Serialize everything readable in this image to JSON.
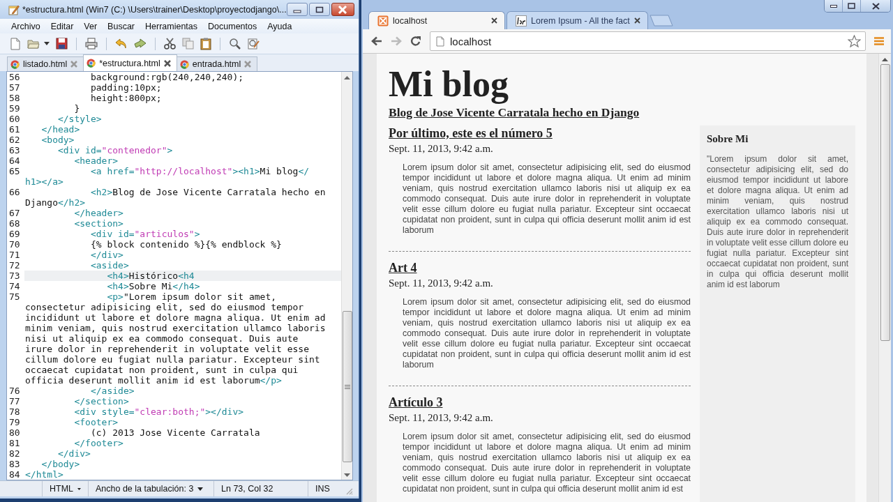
{
  "editor": {
    "title": "*estructura.html (Win7 (C:) \\Users\\trainer\\Desktop\\proyectodjango\\...",
    "menu": [
      "Archivo",
      "Editar",
      "Ver",
      "Buscar",
      "Herramientas",
      "Documentos",
      "Ayuda"
    ],
    "tabs": [
      {
        "label": "listado.html",
        "selected": false
      },
      {
        "label": "*estructura.html",
        "selected": true
      },
      {
        "label": "entrada.html",
        "selected": false
      }
    ],
    "lines": [
      {
        "number": "56",
        "current": false,
        "rows": [
          [
            {
              "kind": "text",
              "text": "            background:rgb(240,240,240);"
            }
          ]
        ]
      },
      {
        "number": "57",
        "current": false,
        "rows": [
          [
            {
              "kind": "text",
              "text": "            padding:10px;"
            }
          ]
        ]
      },
      {
        "number": "58",
        "current": false,
        "rows": [
          [
            {
              "kind": "text",
              "text": "            height:800px;"
            }
          ]
        ]
      },
      {
        "number": "59",
        "current": false,
        "rows": [
          [
            {
              "kind": "text",
              "text": "         }"
            }
          ]
        ]
      },
      {
        "number": "60",
        "current": false,
        "rows": [
          [
            {
              "kind": "markup",
              "text": "      </style>"
            }
          ]
        ]
      },
      {
        "number": "61",
        "current": false,
        "rows": [
          [
            {
              "kind": "markup",
              "text": "   </head>"
            }
          ]
        ]
      },
      {
        "number": "62",
        "current": false,
        "rows": [
          [
            {
              "kind": "markup",
              "text": "   <body>"
            }
          ]
        ]
      },
      {
        "number": "63",
        "current": false,
        "rows": [
          [
            {
              "kind": "markup",
              "text": "      <div id="
            },
            {
              "kind": "string",
              "text": "\"contenedor\""
            },
            {
              "kind": "markup",
              "text": ">"
            }
          ]
        ]
      },
      {
        "number": "64",
        "current": false,
        "rows": [
          [
            {
              "kind": "markup",
              "text": "         <header>"
            }
          ]
        ]
      },
      {
        "number": "65",
        "current": false,
        "rows": [
          [
            {
              "kind": "markup",
              "text": "            <a href="
            },
            {
              "kind": "string",
              "text": "\"http://localhost\""
            },
            {
              "kind": "markup",
              "text": "><h1>"
            },
            {
              "kind": "text",
              "text": "Mi blog"
            },
            {
              "kind": "markup",
              "text": "</"
            }
          ],
          [
            {
              "kind": "markup",
              "text": "h1></a>"
            }
          ]
        ]
      },
      {
        "number": "66",
        "current": false,
        "rows": [
          [
            {
              "kind": "markup",
              "text": "            <h2>"
            },
            {
              "kind": "text",
              "text": "Blog de Jose Vicente Carratala hecho en"
            }
          ],
          [
            {
              "kind": "text",
              "text": "Django"
            },
            {
              "kind": "markup",
              "text": "</h2>"
            }
          ]
        ]
      },
      {
        "number": "67",
        "current": false,
        "rows": [
          [
            {
              "kind": "markup",
              "text": "         </header>"
            }
          ]
        ]
      },
      {
        "number": "68",
        "current": false,
        "rows": [
          [
            {
              "kind": "markup",
              "text": "         <section>"
            }
          ]
        ]
      },
      {
        "number": "69",
        "current": false,
        "rows": [
          [
            {
              "kind": "markup",
              "text": "            <div id="
            },
            {
              "kind": "string",
              "text": "\"articulos\""
            },
            {
              "kind": "markup",
              "text": ">"
            }
          ]
        ]
      },
      {
        "number": "70",
        "current": false,
        "rows": [
          [
            {
              "kind": "text",
              "text": "            {% block contenido %}{% endblock %}"
            }
          ]
        ]
      },
      {
        "number": "71",
        "current": false,
        "rows": [
          [
            {
              "kind": "markup",
              "text": "            </div>"
            }
          ]
        ]
      },
      {
        "number": "72",
        "current": false,
        "rows": [
          [
            {
              "kind": "markup",
              "text": "            <aside>"
            }
          ]
        ]
      },
      {
        "number": "73",
        "current": true,
        "rows": [
          [
            {
              "kind": "markup",
              "text": "               <h4>"
            },
            {
              "kind": "text",
              "text": "Histórico"
            },
            {
              "kind": "markup",
              "text": "<h4"
            }
          ]
        ]
      },
      {
        "number": "74",
        "current": false,
        "rows": [
          [
            {
              "kind": "markup",
              "text": "               <h4>"
            },
            {
              "kind": "text",
              "text": "Sobre Mi"
            },
            {
              "kind": "markup",
              "text": "</h4>"
            }
          ]
        ]
      },
      {
        "number": "75",
        "current": false,
        "rows": [
          [
            {
              "kind": "markup",
              "text": "               <p>"
            },
            {
              "kind": "text",
              "text": "\"Lorem ipsum dolor sit amet,"
            }
          ],
          [
            {
              "kind": "text",
              "text": "consectetur adipisicing elit, sed do eiusmod tempor"
            }
          ],
          [
            {
              "kind": "text",
              "text": "incididunt ut labore et dolore magna aliqua. Ut enim ad"
            }
          ],
          [
            {
              "kind": "text",
              "text": "minim veniam, quis nostrud exercitation ullamco laboris"
            }
          ],
          [
            {
              "kind": "text",
              "text": "nisi ut aliquip ex ea commodo consequat. Duis aute"
            }
          ],
          [
            {
              "kind": "text",
              "text": "irure dolor in reprehenderit in voluptate velit esse"
            }
          ],
          [
            {
              "kind": "text",
              "text": "cillum dolore eu fugiat nulla pariatur. Excepteur sint"
            }
          ],
          [
            {
              "kind": "text",
              "text": "occaecat cupidatat non proident, sunt in culpa qui"
            }
          ],
          [
            {
              "kind": "text",
              "text": "officia deserunt mollit anim id est laborum"
            },
            {
              "kind": "markup",
              "text": "</p>"
            }
          ]
        ]
      },
      {
        "number": "76",
        "current": false,
        "rows": [
          [
            {
              "kind": "markup",
              "text": "            </aside>"
            }
          ]
        ]
      },
      {
        "number": "77",
        "current": false,
        "rows": [
          [
            {
              "kind": "markup",
              "text": "         </section>"
            }
          ]
        ]
      },
      {
        "number": "78",
        "current": false,
        "rows": [
          [
            {
              "kind": "markup",
              "text": "         <div style="
            },
            {
              "kind": "string",
              "text": "\"clear:both;\""
            },
            {
              "kind": "markup",
              "text": "></div>"
            }
          ]
        ]
      },
      {
        "number": "79",
        "current": false,
        "rows": [
          [
            {
              "kind": "markup",
              "text": "         <footer>"
            }
          ]
        ]
      },
      {
        "number": "80",
        "current": false,
        "rows": [
          [
            {
              "kind": "text",
              "text": "            (c) 2013 Jose Vicente Carratala"
            }
          ]
        ]
      },
      {
        "number": "81",
        "current": false,
        "rows": [
          [
            {
              "kind": "markup",
              "text": "         </footer>"
            }
          ]
        ]
      },
      {
        "number": "82",
        "current": false,
        "rows": [
          [
            {
              "kind": "markup",
              "text": "      </div>"
            }
          ]
        ]
      },
      {
        "number": "83",
        "current": false,
        "rows": [
          [
            {
              "kind": "markup",
              "text": "   </body>"
            }
          ]
        ]
      },
      {
        "number": "84",
        "current": false,
        "rows": [
          [
            {
              "kind": "markup",
              "text": "</html>"
            }
          ]
        ]
      }
    ],
    "status_bar": {
      "language": "HTML",
      "tab_width": "Ancho de la tabulación: 3",
      "position": "Ln 73, Col 32",
      "mode": "INS"
    }
  },
  "browser": {
    "tabs": [
      {
        "label": "localhost",
        "selected": true
      },
      {
        "label": "Lorem Ipsum - All the fact",
        "selected": false
      }
    ],
    "address": "localhost",
    "page": {
      "title": "Mi blog",
      "subtitle": "Blog de Jose Vicente Carratala hecho en Django",
      "articles": [
        {
          "title": "Por último, este es el número 5",
          "date": "Sept. 11, 2013, 9:42 a.m.",
          "body": "Lorem ipsum dolor sit amet, consectetur adipisicing elit, sed do eiusmod tempor incididunt ut labore et dolore magna aliqua. Ut enim ad minim veniam, quis nostrud exercitation ullamco laboris nisi ut aliquip ex ea commodo consequat. Duis aute irure dolor in reprehenderit in voluptate velit esse cillum dolore eu fugiat nulla pariatur. Excepteur sint occaecat cupidatat non proident, sunt in culpa qui officia deserunt mollit anim id est laborum"
        },
        {
          "title": "Art 4",
          "date": "Sept. 11, 2013, 9:42 a.m.",
          "body": "Lorem ipsum dolor sit amet, consectetur adipisicing elit, sed do eiusmod tempor incididunt ut labore et dolore magna aliqua. Ut enim ad minim veniam, quis nostrud exercitation ullamco laboris nisi ut aliquip ex ea commodo consequat. Duis aute irure dolor in reprehenderit in voluptate velit esse cillum dolore eu fugiat nulla pariatur. Excepteur sint occaecat cupidatat non proident, sunt in culpa qui officia deserunt mollit anim id est laborum"
        },
        {
          "title": "Artículo 3",
          "date": "Sept. 11, 2013, 9:42 a.m.",
          "body": "Lorem ipsum dolor sit amet, consectetur adipisicing elit, sed do eiusmod tempor incididunt ut labore et dolore magna aliqua. Ut enim ad minim veniam, quis nostrud exercitation ullamco laboris nisi ut aliquip ex ea commodo consequat. Duis aute irure dolor in reprehenderit in voluptate velit esse cillum dolore eu fugiat nulla pariatur. Excepteur sint occaecat cupidatat non proident, sunt in culpa qui officia deserunt mollit anim id est"
        }
      ],
      "aside": {
        "heading": "Sobre Mi",
        "body": "\"Lorem ipsum dolor sit amet, consectetur adipisicing elit, sed do eiusmod tempor incididunt ut labore et dolore magna aliqua. Ut enim ad minim veniam, quis nostrud exercitation ullamco laboris nisi ut aliquip ex ea commodo consequat. Duis aute irure dolor in reprehenderit in voluptate velit esse cillum dolore eu fugiat nulla pariatur. Excepteur sint occaecat cupidatat non proident, sunt in culpa qui officia deserunt mollit anim id est laborum"
      }
    }
  }
}
